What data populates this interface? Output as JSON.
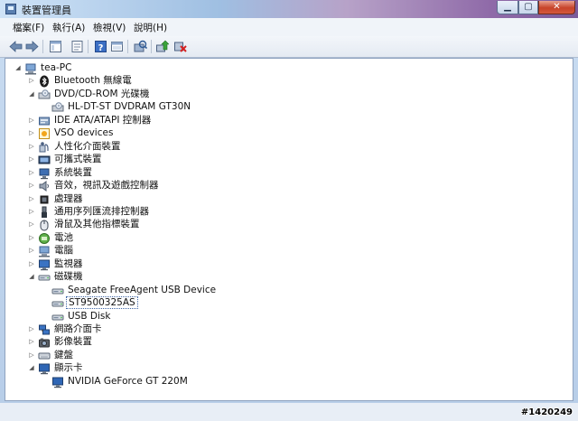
{
  "window": {
    "title": "裝置管理員",
    "min_label": "▁",
    "max_label": "▢",
    "close_label": "✕"
  },
  "menu": [
    "檔案(F)",
    "執行(A)",
    "檢視(V)",
    "說明(H)"
  ],
  "toolbar": [
    "back-arrow",
    "forward-arrow",
    "device-view",
    "properties",
    "help",
    "device-list",
    "scan-hardware",
    "update-driver",
    "uninstall-device"
  ],
  "tree": [
    {
      "label": "tea-PC",
      "icon": "computer-icon",
      "expander": "◢"
    },
    {
      "label": "Bluetooth 無線電",
      "icon": "bluetooth-icon",
      "expander": "▷"
    },
    {
      "label": "DVD/CD-ROM 光碟機",
      "icon": "dvd-drive-icon",
      "expander": "◢"
    },
    {
      "label": "HL-DT-ST DVDRAM GT30N",
      "icon": "dvd-drive-icon",
      "expander": ""
    },
    {
      "label": "IDE ATA/ATAPI 控制器",
      "icon": "ide-controller-icon",
      "expander": "▷"
    },
    {
      "label": "VSO devices",
      "icon": "vso-device-icon",
      "expander": "▷"
    },
    {
      "label": "人性化介面裝置",
      "icon": "hid-icon",
      "expander": "▷"
    },
    {
      "label": "可攜式裝置",
      "icon": "portable-device-icon",
      "expander": "▷"
    },
    {
      "label": "系統裝置",
      "icon": "system-device-icon",
      "expander": "▷"
    },
    {
      "label": "音效，視訊及遊戲控制器",
      "icon": "sound-icon",
      "expander": "▷"
    },
    {
      "label": "處理器",
      "icon": "processor-icon",
      "expander": "▷"
    },
    {
      "label": "通用序列匯流排控制器",
      "icon": "usb-icon",
      "expander": "▷"
    },
    {
      "label": "滑鼠及其他指標裝置",
      "icon": "mouse-icon",
      "expander": "▷"
    },
    {
      "label": "電池",
      "icon": "battery-icon",
      "expander": "▷"
    },
    {
      "label": "電腦",
      "icon": "computer-icon",
      "expander": "▷"
    },
    {
      "label": "監視器",
      "icon": "monitor-icon",
      "expander": "▷"
    },
    {
      "label": "磁碟機",
      "icon": "disk-drive-icon",
      "expander": "◢"
    },
    {
      "label": "Seagate FreeAgent USB Device",
      "icon": "disk-drive-icon",
      "expander": ""
    },
    {
      "label": "ST9500325AS",
      "icon": "disk-drive-icon",
      "expander": "",
      "selected": true
    },
    {
      "label": "USB Disk",
      "icon": "disk-drive-icon",
      "expander": ""
    },
    {
      "label": "網路介面卡",
      "icon": "network-adapter-icon",
      "expander": "▷"
    },
    {
      "label": "影像裝置",
      "icon": "imaging-device-icon",
      "expander": "▷"
    },
    {
      "label": "鍵盤",
      "icon": "keyboard-icon",
      "expander": "▷"
    },
    {
      "label": "顯示卡",
      "icon": "display-adapter-icon",
      "expander": "◢"
    },
    {
      "label": "NVIDIA GeForce GT 220M",
      "icon": "display-adapter-icon",
      "expander": ""
    }
  ],
  "watermark": "#1420249"
}
